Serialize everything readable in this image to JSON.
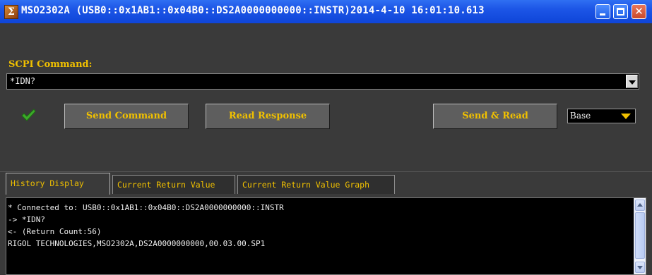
{
  "window": {
    "title": "MSO2302A (USB0::0x1AB1::0x04B0::DS2A0000000000::INSTR)2014-4-10 16:01:10.613",
    "icon": "sigma-app-icon"
  },
  "command": {
    "label": "SCPI Command:",
    "value": "*IDN?"
  },
  "buttons": {
    "send": "Send Command",
    "read": "Read Response",
    "send_read": "Send & Read"
  },
  "base_select": {
    "value": "Base"
  },
  "tabs": [
    {
      "label": "History Display",
      "active": true
    },
    {
      "label": "Current Return Value",
      "active": false
    },
    {
      "label": "Current Return Value Graph",
      "active": false
    }
  ],
  "history": [
    " * Connected to: USB0::0x1AB1::0x04B0::DS2A0000000000::INSTR",
    "-> *IDN?",
    "<- (Return Count:56)",
    "RIGOL TECHNOLOGIES,MSO2302A,DS2A0000000000,00.03.00.SP1"
  ],
  "colors": {
    "accent": "#f0c000",
    "panel": "#3a3a3a",
    "titlebar": "#1c55e6",
    "check": "#3caa2a"
  }
}
